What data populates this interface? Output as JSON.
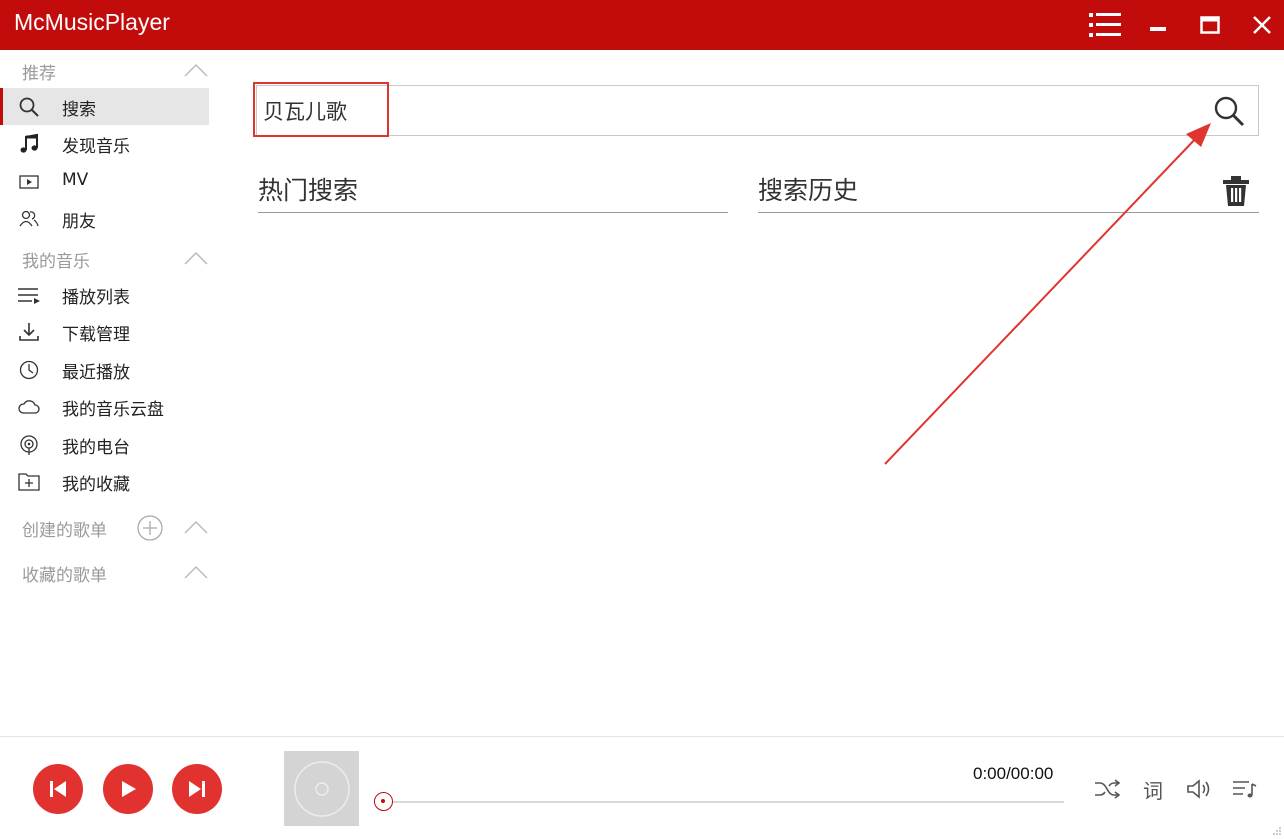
{
  "app": {
    "title": "McMusicPlayer"
  },
  "sidebar": {
    "recommend": {
      "header": "推荐",
      "items": [
        {
          "label": "搜索",
          "icon": "search-icon",
          "active": true
        },
        {
          "label": "发现音乐",
          "icon": "music-note-icon"
        },
        {
          "label": "MV",
          "icon": "video-play-icon"
        },
        {
          "label": "朋友",
          "icon": "friends-icon"
        }
      ]
    },
    "my_music": {
      "header": "我的音乐",
      "items": [
        {
          "label": "播放列表",
          "icon": "playlist-icon"
        },
        {
          "label": "下载管理",
          "icon": "download-icon"
        },
        {
          "label": "最近播放",
          "icon": "clock-icon"
        },
        {
          "label": "我的音乐云盘",
          "icon": "cloud-icon"
        },
        {
          "label": "我的电台",
          "icon": "radio-icon"
        },
        {
          "label": "我的收藏",
          "icon": "favorite-folder-icon"
        }
      ]
    },
    "created_playlists": {
      "header": "创建的歌单"
    },
    "collected_playlists": {
      "header": "收藏的歌单"
    }
  },
  "search": {
    "value": "贝瓦儿歌"
  },
  "panels": {
    "hot": {
      "title": "热门搜索"
    },
    "history": {
      "title": "搜索历史"
    }
  },
  "player": {
    "time": "0:00/00:00",
    "lyrics_label": "词",
    "progress": 0
  },
  "colors": {
    "brand": "#c20c0c",
    "button": "#e2322f",
    "annotation": "#e0342f"
  }
}
